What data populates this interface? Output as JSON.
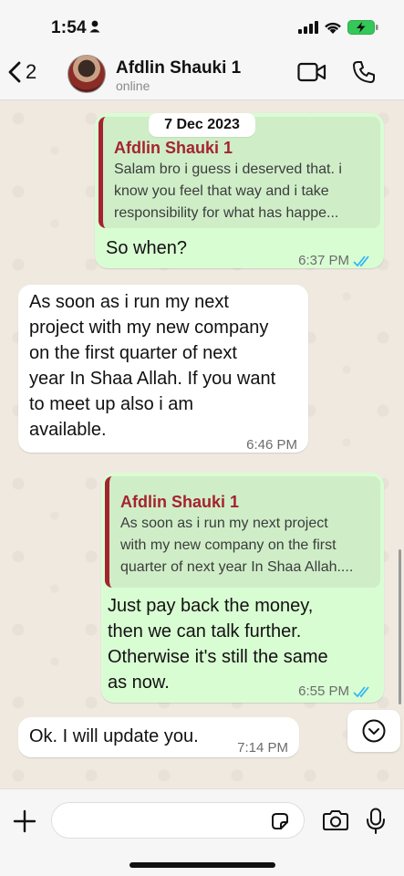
{
  "status_bar": {
    "time": "1:54"
  },
  "header": {
    "back_count": "2",
    "contact_name": "Afdlin Shauki 1",
    "contact_status": "online"
  },
  "chat": {
    "date_label": "7 Dec 2023",
    "messages": [
      {
        "direction": "out",
        "quote_name": "Afdlin Shauki 1",
        "quote_text": "Salam bro i guess i deserved that.  i\nknow you feel that way and i take\nresponsibility for what has happe...",
        "text": "So when?",
        "time": "6:37 PM",
        "read": true
      },
      {
        "direction": "in",
        "text": "As soon as i run my next\nproject with my new company\non the first quarter of next\nyear In Shaa Allah. If you want\nto meet up also i am\navailable.",
        "time": "6:46 PM"
      },
      {
        "direction": "out",
        "quote_name": "Afdlin Shauki 1",
        "quote_text": "As soon as i run my next project\nwith my new company on the first\nquarter of next year In Shaa Allah....",
        "text": "Just pay back the money,\nthen we can talk further.\nOtherwise it's still the same\nas now.",
        "time": "6:55 PM",
        "read": true
      },
      {
        "direction": "in",
        "text": "Ok. I will update you.",
        "time": "7:14 PM"
      }
    ]
  },
  "input": {
    "placeholder": ""
  },
  "colors": {
    "outgoing_bubble": "#d9fdd3",
    "incoming_bubble": "#ffffff",
    "quote_accent": "#a5232f",
    "read_ticks": "#34b7f1",
    "battery": "#34c759"
  },
  "icons": [
    "person-icon",
    "signal-icon",
    "wifi-icon",
    "battery-charging-icon",
    "back-chevron-icon",
    "video-call-icon",
    "phone-icon",
    "double-check-icon",
    "scroll-down-icon",
    "plus-icon",
    "sticker-icon",
    "camera-icon",
    "microphone-icon"
  ]
}
